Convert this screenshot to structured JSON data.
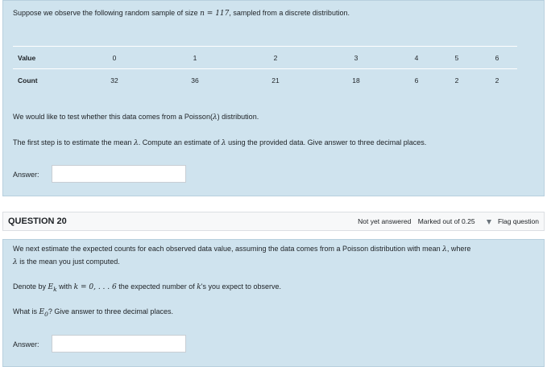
{
  "q19": {
    "intro_pre": "Suppose we observe the following random sample of size ",
    "intro_math": "n = 117",
    "intro_post": ", sampled from a discrete distribution.",
    "table": {
      "row1_header": "Value",
      "values": [
        "0",
        "1",
        "2",
        "3",
        "4",
        "5",
        "6"
      ],
      "row2_header": "Count",
      "counts": [
        "32",
        "36",
        "21",
        "18",
        "6",
        "2",
        "2"
      ]
    },
    "poisson_pre": "We would like to test whether this data comes from a Poisson(",
    "lambda": "λ",
    "poisson_post": ") distribution.",
    "step_pre": "The first step is to estimate the mean ",
    "step_mid": ". Compute an estimate of ",
    "step_post": " using the provided data. Give answer to three decimal places.",
    "answer_label": "Answer:",
    "answer_value": ""
  },
  "q20": {
    "title": "QUESTION 20",
    "status": "Not yet answered",
    "marks": "Marked out of 0.25",
    "flag_label": "Flag question",
    "para1_pre": "We next estimate the expected counts for each observed data value, assuming the data comes from a Poisson distribution with mean ",
    "para1_post": ", where",
    "para2_post": " is the mean you just computed.",
    "denote_pre": "Denote by ",
    "denote_ek": "E",
    "denote_k_sub": "k",
    "denote_with": " with ",
    "denote_range": "k = 0, . . . 6",
    "denote_mid": " the expected number of ",
    "denote_k": "k",
    "denote_post": "'s you expect to observe.",
    "what_pre": "What is ",
    "what_e0": "E",
    "what_sub": "0",
    "what_post": "? Give answer to three decimal places.",
    "answer_label": "Answer:",
    "answer_value": ""
  }
}
